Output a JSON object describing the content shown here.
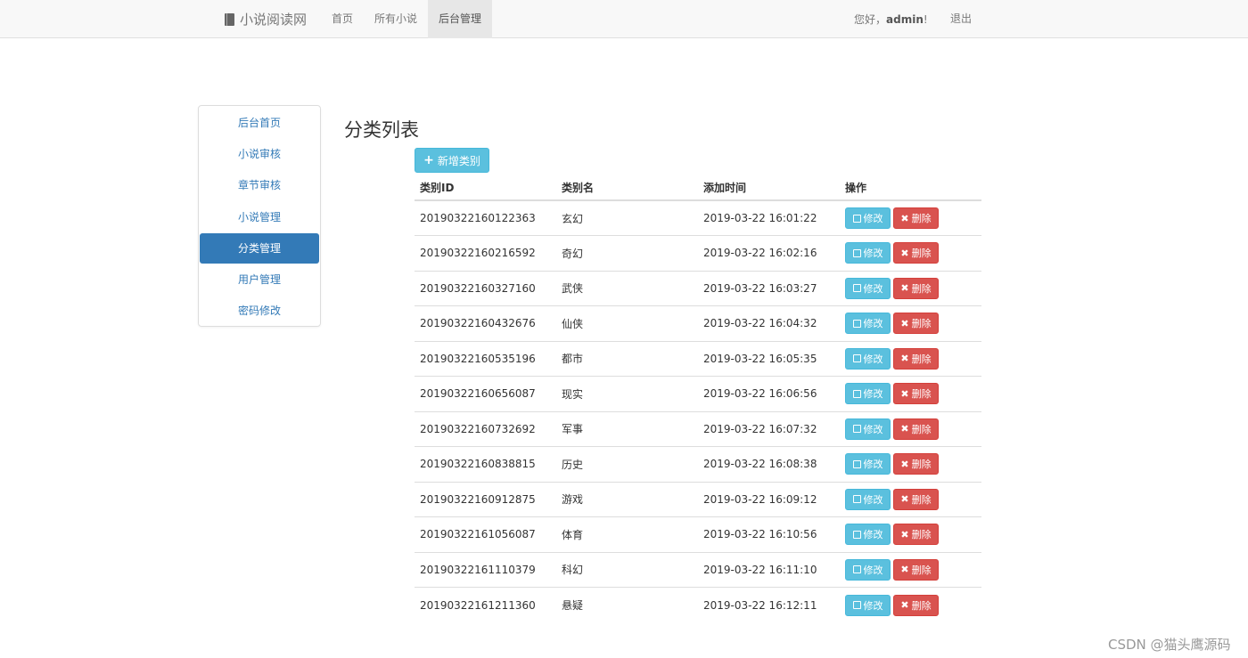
{
  "navbar": {
    "brand": "小说阅读网",
    "items": [
      {
        "label": "首页",
        "active": false
      },
      {
        "label": "所有小说",
        "active": false
      },
      {
        "label": "后台管理",
        "active": true
      }
    ],
    "greeting_prefix": "您好，",
    "username": "admin",
    "greeting_suffix": "!",
    "logout": "退出"
  },
  "sidebar": {
    "items": [
      {
        "label": "后台首页",
        "active": false
      },
      {
        "label": "小说审核",
        "active": false
      },
      {
        "label": "章节审核",
        "active": false
      },
      {
        "label": "小说管理",
        "active": false
      },
      {
        "label": "分类管理",
        "active": true
      },
      {
        "label": "用户管理",
        "active": false
      },
      {
        "label": "密码修改",
        "active": false
      }
    ]
  },
  "main": {
    "title": "分类列表",
    "add_button": "新增类别",
    "columns": [
      "类别ID",
      "类别名",
      "添加时间",
      "操作"
    ],
    "edit_label": "修改",
    "delete_label": "删除",
    "rows": [
      {
        "id": "20190322160122363",
        "name": "玄幻",
        "time": "2019-03-22 16:01:22"
      },
      {
        "id": "20190322160216592",
        "name": "奇幻",
        "time": "2019-03-22 16:02:16"
      },
      {
        "id": "20190322160327160",
        "name": "武侠",
        "time": "2019-03-22 16:03:27"
      },
      {
        "id": "20190322160432676",
        "name": "仙侠",
        "time": "2019-03-22 16:04:32"
      },
      {
        "id": "20190322160535196",
        "name": "都市",
        "time": "2019-03-22 16:05:35"
      },
      {
        "id": "20190322160656087",
        "name": "现实",
        "time": "2019-03-22 16:06:56"
      },
      {
        "id": "20190322160732692",
        "name": "军事",
        "time": "2019-03-22 16:07:32"
      },
      {
        "id": "20190322160838815",
        "name": "历史",
        "time": "2019-03-22 16:08:38"
      },
      {
        "id": "20190322160912875",
        "name": "游戏",
        "time": "2019-03-22 16:09:12"
      },
      {
        "id": "20190322161056087",
        "name": "体育",
        "time": "2019-03-22 16:10:56"
      },
      {
        "id": "20190322161110379",
        "name": "科幻",
        "time": "2019-03-22 16:11:10"
      },
      {
        "id": "20190322161211360",
        "name": "悬疑",
        "time": "2019-03-22 16:12:11"
      }
    ]
  },
  "watermark": "CSDN @猫头鹰源码"
}
